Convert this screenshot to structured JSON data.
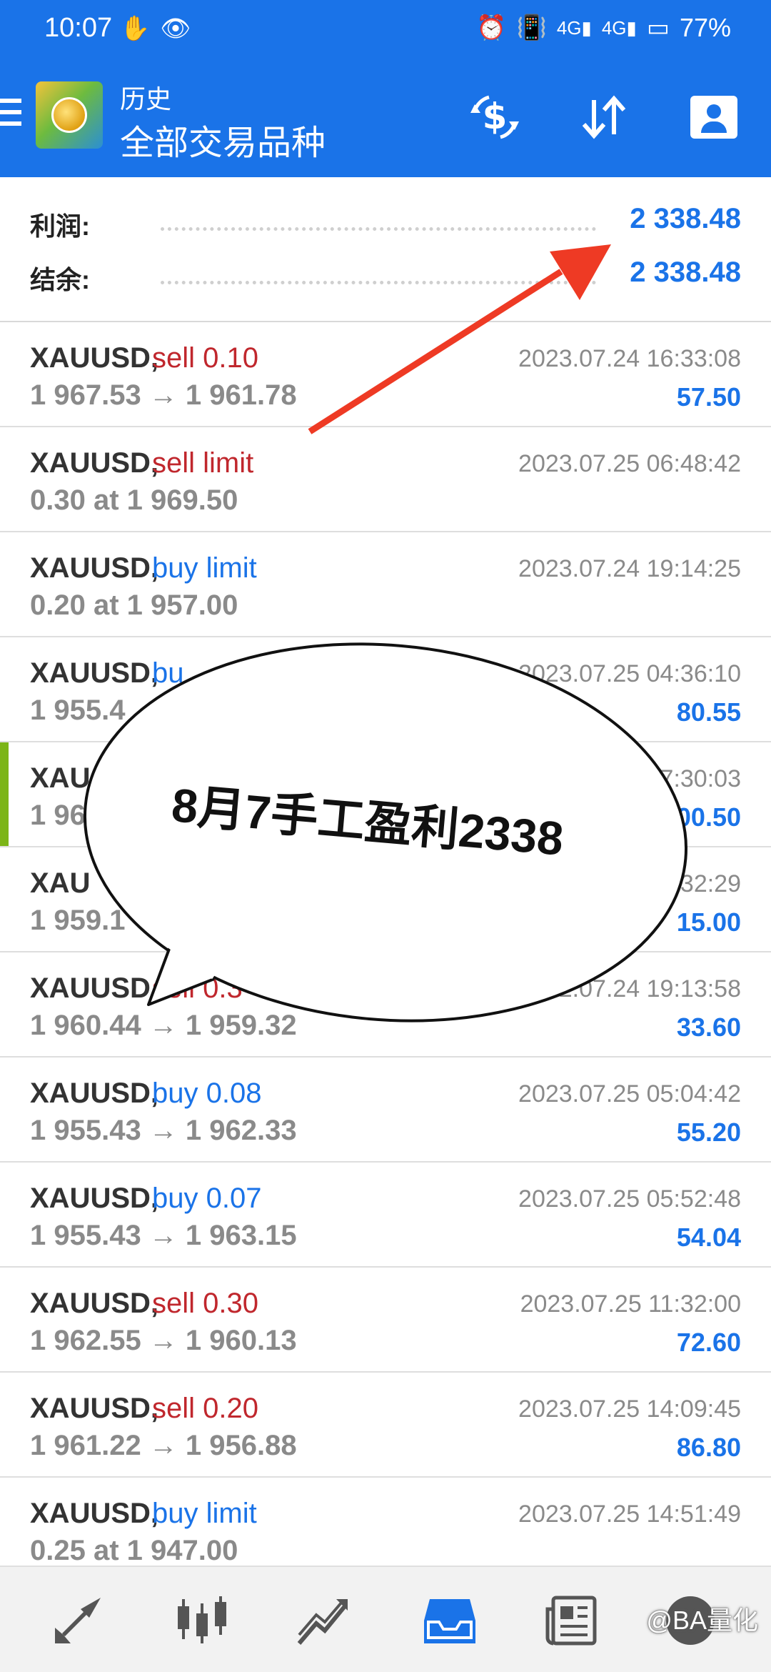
{
  "status_bar": {
    "time": "10:07",
    "battery": "77%",
    "network_1": "4G",
    "network_2": "4G"
  },
  "app_bar": {
    "subtitle": "历史",
    "title": "全部交易品种",
    "accent_color": "#1a73e8"
  },
  "summary": {
    "profit_label": "利润:",
    "profit_value": "2 338.48",
    "balance_label": "结余:",
    "balance_value": "2 338.48"
  },
  "orders": [
    {
      "symbol": "XAUUSD,",
      "type": "sell 0.10",
      "side": "sell",
      "price": "1 967.53 → 1 961.78",
      "time": "2023.07.24 16:33:08",
      "profit": "57.50"
    },
    {
      "symbol": "XAUUSD,",
      "type": "sell limit",
      "side": "sell",
      "price": "0.30 at 1 969.50",
      "time": "2023.07.25 06:48:42",
      "profit": ""
    },
    {
      "symbol": "XAUUSD,",
      "type": "buy limit",
      "side": "buy",
      "price": "0.20 at 1 957.00",
      "time": "2023.07.24 19:14:25",
      "profit": ""
    },
    {
      "symbol": "XAUUSD,",
      "type": "bu",
      "side": "buy",
      "price": "1 955.4",
      "time": "2023.07.25 04:36:10",
      "profit": "80.55"
    },
    {
      "symbol": "XAU",
      "type": "",
      "side": "buy",
      "price": "1 96",
      "time": "7:30:03",
      "profit": "00.50"
    },
    {
      "symbol": "XAU",
      "type": "",
      "side": "buy",
      "price": "1 959.1",
      "time": "32:29",
      "profit": "15.00"
    },
    {
      "symbol": "XAUUSD,",
      "type": "sell 0.3",
      "side": "sell",
      "price": "1 960.44 → 1 959.32",
      "time": "2.07.24 19:13:58",
      "profit": "33.60"
    },
    {
      "symbol": "XAUUSD,",
      "type": "buy 0.08",
      "side": "buy",
      "price": "1 955.43 → 1 962.33",
      "time": "2023.07.25 05:04:42",
      "profit": "55.20"
    },
    {
      "symbol": "XAUUSD,",
      "type": "buy 0.07",
      "side": "buy",
      "price": "1 955.43 → 1 963.15",
      "time": "2023.07.25 05:52:48",
      "profit": "54.04"
    },
    {
      "symbol": "XAUUSD,",
      "type": "sell 0.30",
      "side": "sell",
      "price": "1 962.55 → 1 960.13",
      "time": "2023.07.25 11:32:00",
      "profit": "72.60"
    },
    {
      "symbol": "XAUUSD,",
      "type": "sell 0.20",
      "side": "sell",
      "price": "1 961.22 → 1 956.88",
      "time": "2023.07.25 14:09:45",
      "profit": "86.80"
    },
    {
      "symbol": "XAUUSD,",
      "type": "buy limit",
      "side": "buy",
      "price": "0.25 at 1 947.00",
      "time": "2023.07.25 14:51:49",
      "profit": ""
    }
  ],
  "bubble": {
    "text": "8月7手工盈利2338"
  },
  "watermark": "@BA量化",
  "colors": {
    "sell": "#c0272d",
    "buy": "#1a73e8",
    "arrow": "#ee3a24",
    "highlight": "#7cb518"
  }
}
